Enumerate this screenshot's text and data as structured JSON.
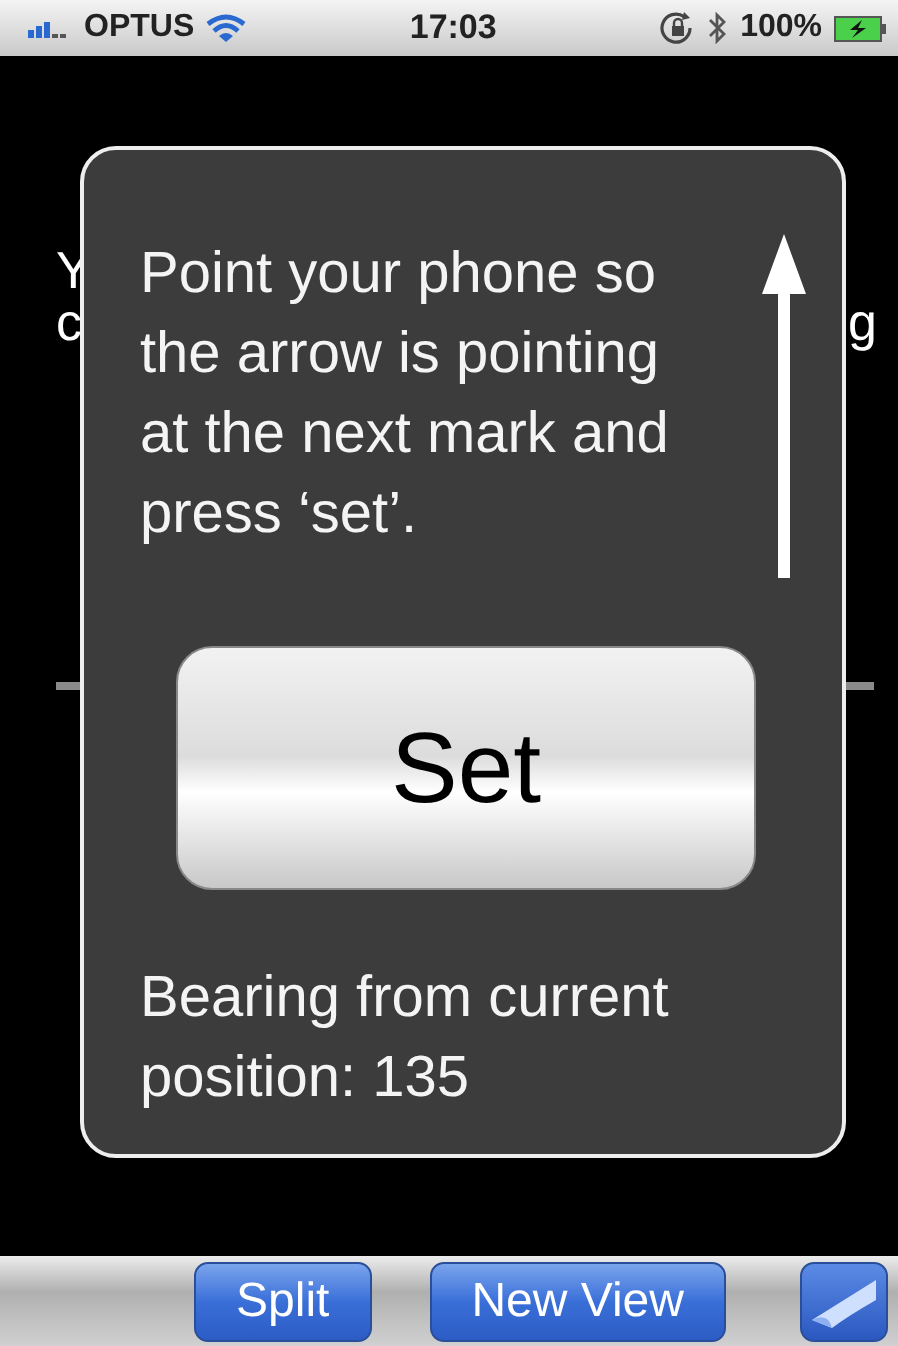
{
  "status_bar": {
    "carrier": "OPTUS",
    "time": "17:03",
    "battery": "100%"
  },
  "background_fragments": [
    "Y",
    "c",
    "g"
  ],
  "popup": {
    "message": "Point your phone so the arrow is pointing at the next mark and press ‘set’.",
    "button": "Set",
    "bearing": "Bearing from current position: 135"
  },
  "toolbar": {
    "buttons": [
      "Split",
      "New View"
    ]
  }
}
